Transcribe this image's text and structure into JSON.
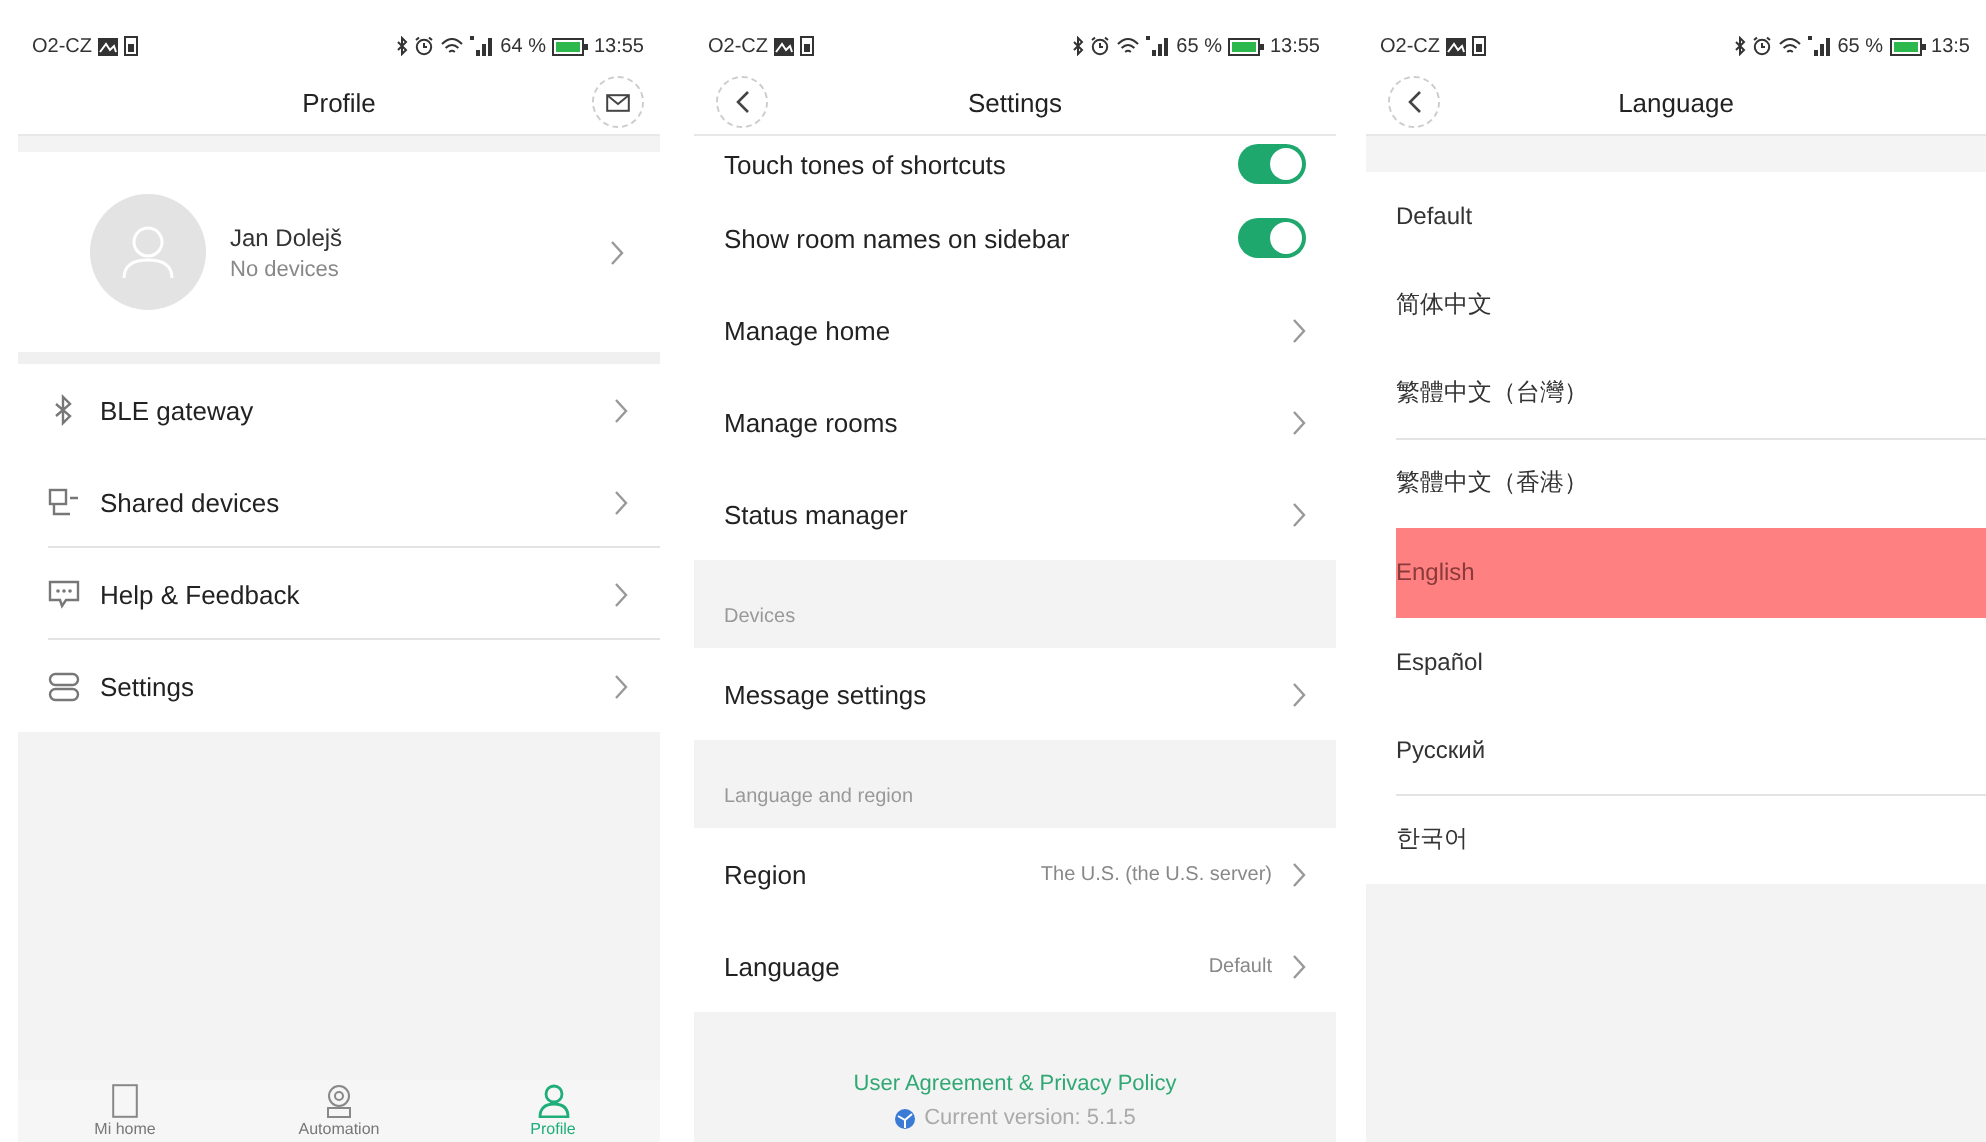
{
  "screens": [
    {
      "kind": "profile",
      "status_bar": {
        "carrier": "O2-CZ",
        "battery": "64 %",
        "time": "13:55"
      },
      "title": "Profile",
      "user": {
        "name": "Jan Dolejš",
        "subtitle": "No devices"
      },
      "menu": [
        {
          "label": "BLE gateway",
          "divider_below": false
        },
        {
          "label": "Shared devices",
          "divider_below": true
        },
        {
          "label": "Help & Feedback",
          "divider_below": true
        },
        {
          "label": "Settings",
          "divider_below": false
        }
      ],
      "nav": [
        {
          "label": "Mi home",
          "selected": false
        },
        {
          "label": "Automation",
          "selected": false
        },
        {
          "label": "Profile",
          "selected": true
        }
      ]
    },
    {
      "kind": "settings",
      "status_bar": {
        "carrier": "O2-CZ",
        "battery": "65 %",
        "time": "13:55"
      },
      "title": "Settings",
      "rows": [
        {
          "kind": "toggle",
          "label": "Touch tones of shortcuts",
          "on": true
        },
        {
          "kind": "toggle",
          "label": "Show room names on sidebar",
          "on": true
        },
        {
          "kind": "link",
          "label": "Manage home"
        },
        {
          "kind": "link",
          "label": "Manage rooms"
        },
        {
          "kind": "link",
          "label": "Status manager"
        },
        {
          "kind": "section",
          "label": "Devices"
        },
        {
          "kind": "link",
          "label": "Message settings"
        },
        {
          "kind": "section",
          "label": "Language and region"
        },
        {
          "kind": "link",
          "label": "Region",
          "value": "The U.S. (the U.S. server)"
        },
        {
          "kind": "link",
          "label": "Language",
          "value": "Default"
        }
      ],
      "footer": {
        "link": "User Agreement & Privacy Policy",
        "version": "Current version: 5.1.5"
      }
    },
    {
      "kind": "language",
      "status_bar": {
        "carrier": "O2-CZ",
        "battery": "65 %",
        "time": "13:5"
      },
      "title": "Language",
      "options": [
        {
          "label": "Default",
          "selected": false,
          "divider_below": false
        },
        {
          "label": "简体中文",
          "selected": false,
          "divider_below": false
        },
        {
          "label": "繁體中文（台灣）",
          "selected": false,
          "divider_below": true
        },
        {
          "label": "繁體中文（香港）",
          "selected": false,
          "divider_below": false
        },
        {
          "label": "English",
          "selected": true,
          "divider_below": false
        },
        {
          "label": "Español",
          "selected": false,
          "divider_below": false
        },
        {
          "label": "Русский",
          "selected": false,
          "divider_below": true
        },
        {
          "label": "한국어",
          "selected": false,
          "divider_below": false
        }
      ]
    }
  ]
}
